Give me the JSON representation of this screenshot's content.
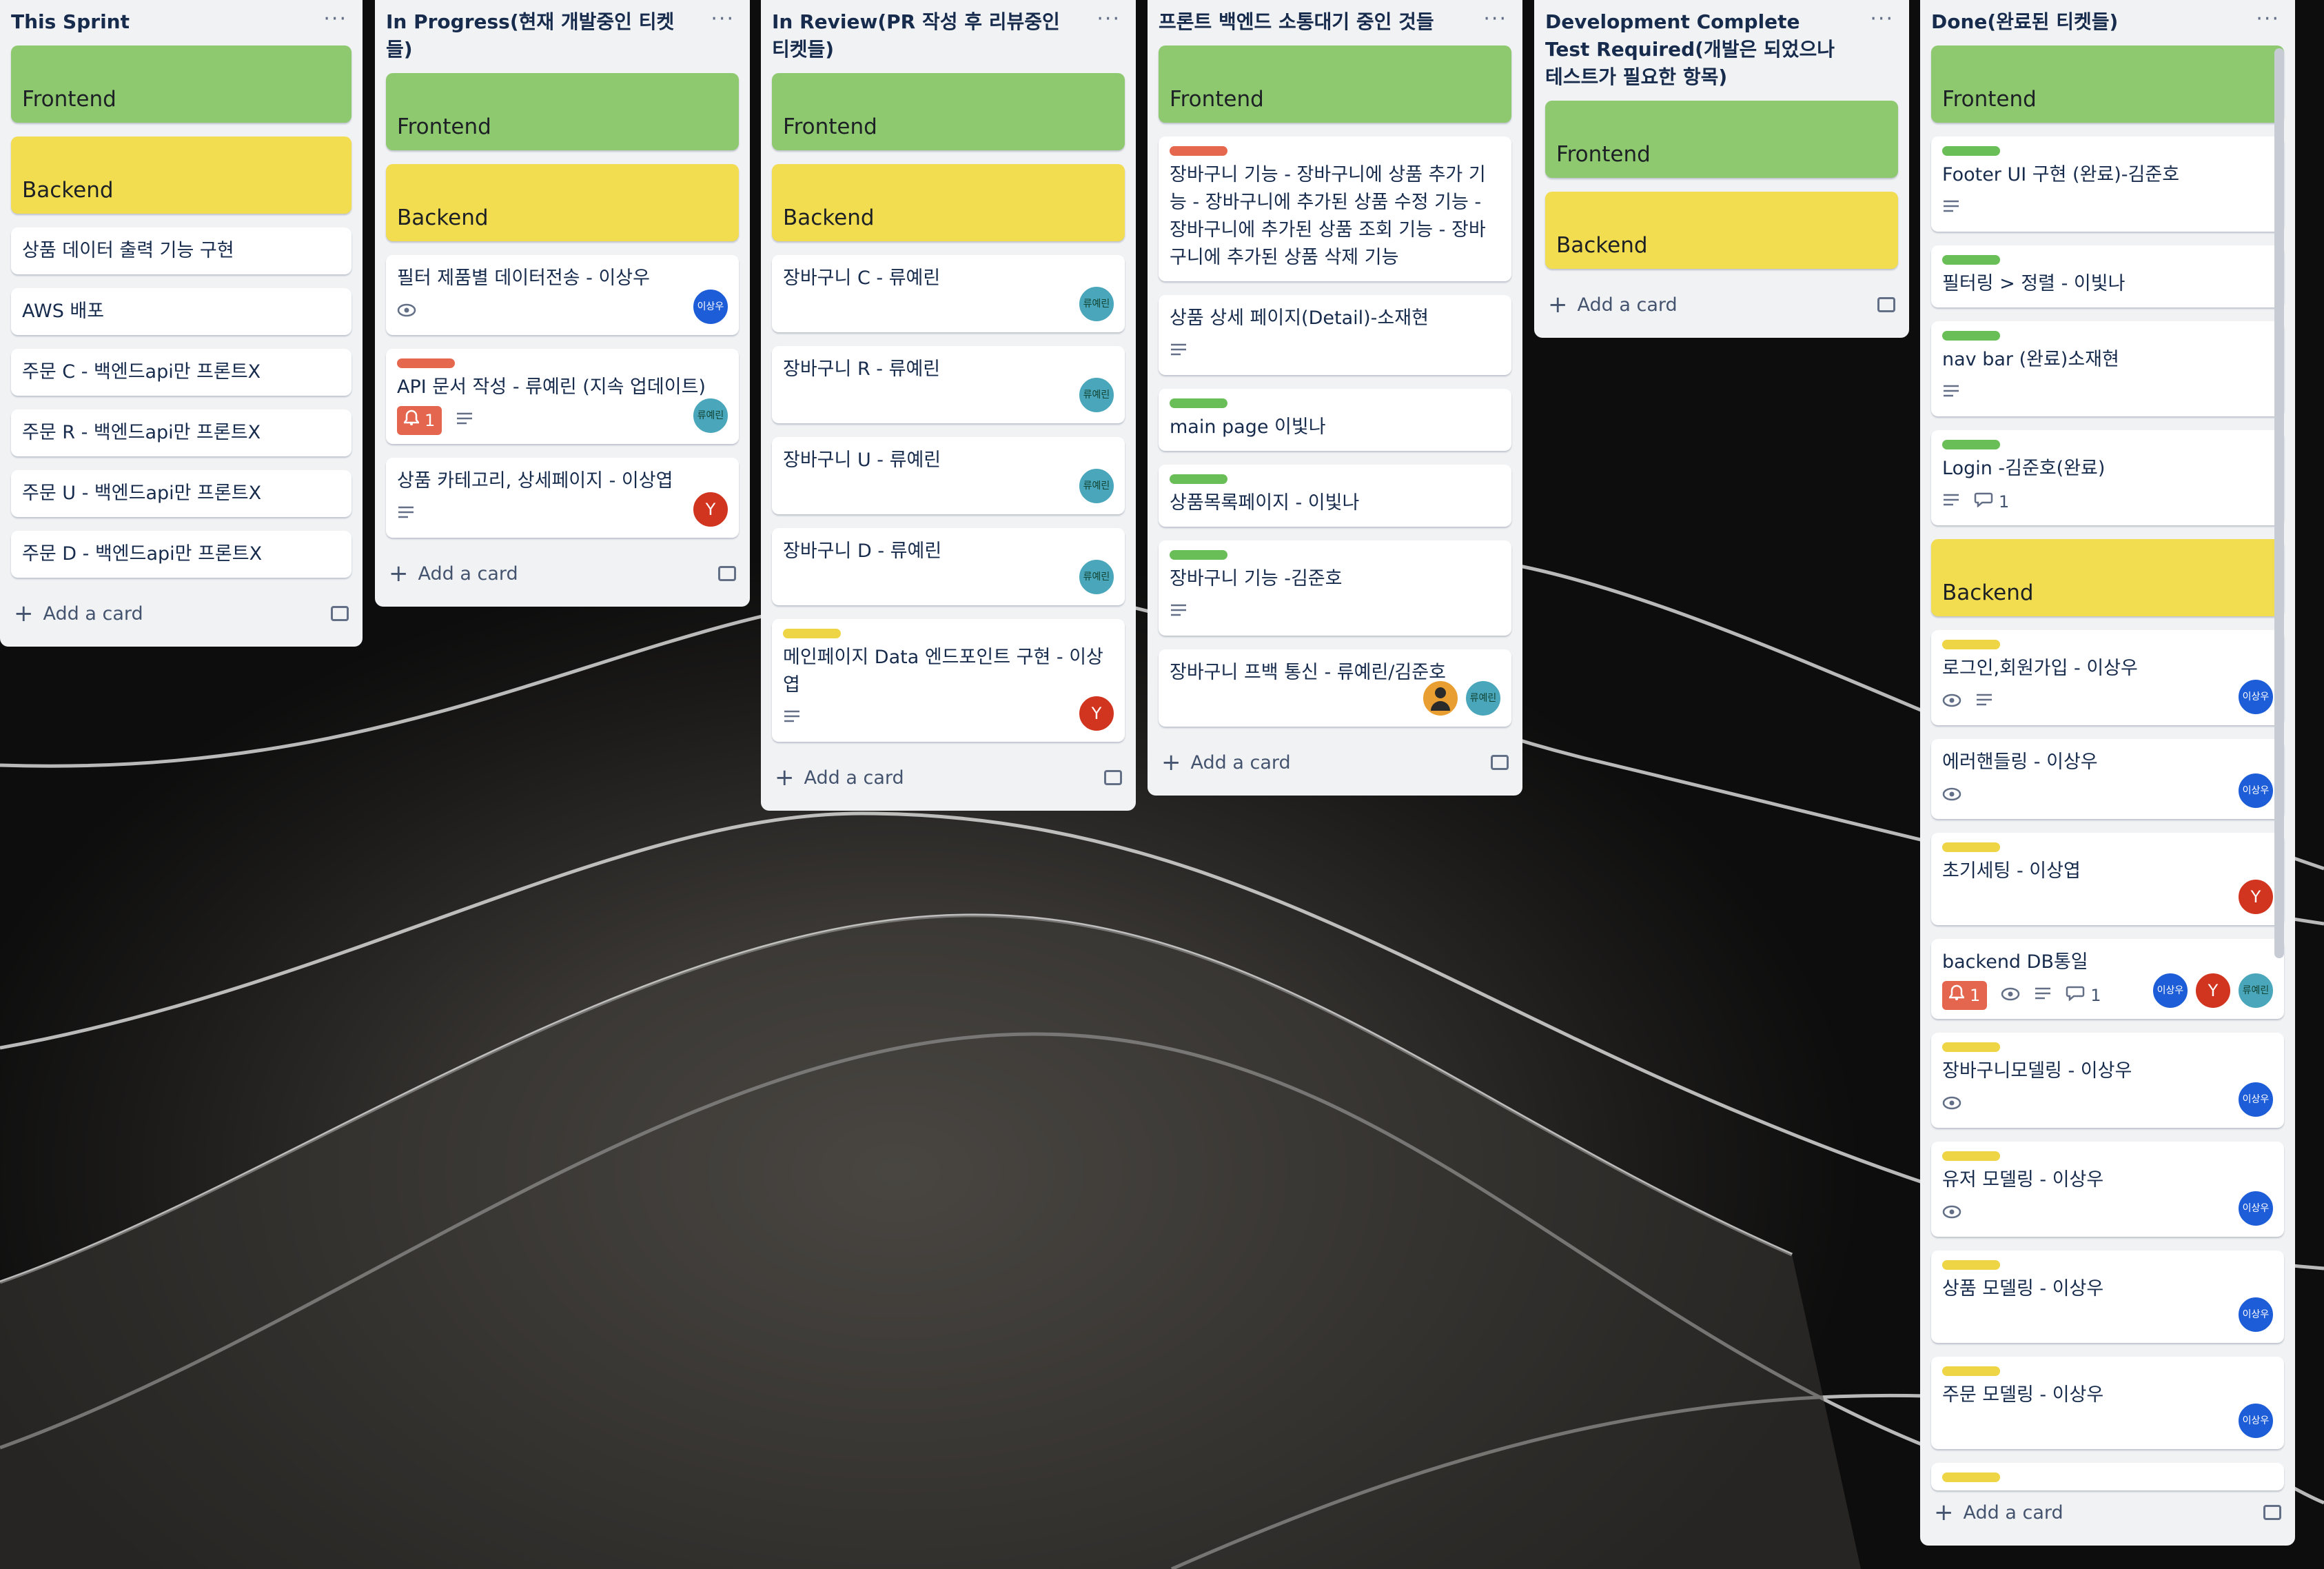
{
  "lists": [
    {
      "title": "This Sprint",
      "add_label": "Add a card",
      "cards": [
        {
          "type": "category",
          "color": "green",
          "title": "Frontend"
        },
        {
          "type": "category",
          "color": "yellow",
          "title": "Backend"
        },
        {
          "type": "card",
          "title": "상품 데이터 출력 기능 구현"
        },
        {
          "type": "card",
          "title": "AWS 배포"
        },
        {
          "type": "card",
          "title": "주문 C - 백엔드api만 프론트X"
        },
        {
          "type": "card",
          "title": "주문 R - 백엔드api만 프론트X"
        },
        {
          "type": "card",
          "title": "주문 U - 백엔드api만 프론트X"
        },
        {
          "type": "card",
          "title": "주문 D - 백엔드api만 프론트X"
        }
      ]
    },
    {
      "title": "In Progress(현재 개발중인 티켓들)",
      "add_label": "Add a card",
      "cards": [
        {
          "type": "category",
          "color": "green",
          "title": "Frontend"
        },
        {
          "type": "category",
          "color": "yellow",
          "title": "Backend"
        },
        {
          "type": "card",
          "title": "필터 제품별 데이터전송 - 이상우",
          "eye": true,
          "avatars": [
            {
              "color": "blue",
              "text": "이상우"
            }
          ]
        },
        {
          "type": "card",
          "label": "red",
          "title": "API 문서 작성 - 류예린 (지속 업데이트)",
          "alert": "1",
          "desc": true,
          "avatars": [
            {
              "color": "teal",
              "text": "류예린"
            }
          ]
        },
        {
          "type": "card",
          "title": "상품 카테고리, 상세페이지 - 이상엽",
          "desc": true,
          "avatars": [
            {
              "color": "red",
              "text": "Y"
            }
          ]
        }
      ]
    },
    {
      "title": "In Review(PR 작성 후 리뷰중인 티켓들)",
      "add_label": "Add a card",
      "cards": [
        {
          "type": "category",
          "color": "green",
          "title": "Frontend"
        },
        {
          "type": "category",
          "color": "yellow",
          "title": "Backend"
        },
        {
          "type": "card",
          "title": "장바구니 C - 류예린",
          "tall": true,
          "avatars": [
            {
              "color": "teal",
              "text": "류예린"
            }
          ]
        },
        {
          "type": "card",
          "title": "장바구니 R - 류예린",
          "tall": true,
          "avatars": [
            {
              "color": "teal",
              "text": "류예린"
            }
          ]
        },
        {
          "type": "card",
          "title": "장바구니 U - 류예린",
          "tall": true,
          "avatars": [
            {
              "color": "teal",
              "text": "류예린"
            }
          ]
        },
        {
          "type": "card",
          "title": "장바구니 D - 류예린",
          "tall": true,
          "avatars": [
            {
              "color": "teal",
              "text": "류예린"
            }
          ]
        },
        {
          "type": "card",
          "label": "yellow",
          "title": "메인페이지 Data 엔드포인트 구현 - 이상엽",
          "desc": true,
          "avatars": [
            {
              "color": "red",
              "text": "Y"
            }
          ]
        }
      ]
    },
    {
      "title": "프론트 백엔드 소통대기 중인 것들",
      "add_label": "Add a card",
      "cards": [
        {
          "type": "category",
          "color": "green",
          "title": "Frontend"
        },
        {
          "type": "card",
          "label": "red",
          "title": "장바구니 기능 - 장바구니에 상품 추가 기능 - 장바구니에 추가된 상품 수정 기능 - 장바구니에 추가된 상품 조회 기능 - 장바구니에 추가된 상품 삭제 기능"
        },
        {
          "type": "card",
          "title": "상품 상세 페이지(Detail)-소재현",
          "desc": true
        },
        {
          "type": "card",
          "label": "green",
          "title": "main page 이빛나"
        },
        {
          "type": "card",
          "label": "green",
          "title": "상품목록페이지 - 이빛나"
        },
        {
          "type": "card",
          "label": "green",
          "title": "장바구니 기능 -김준호",
          "desc": true
        },
        {
          "type": "card",
          "title": "장바구니 프백 통신 - 류예린/김준호",
          "tall": true,
          "avatars": [
            {
              "color": "orange",
              "text": "person"
            },
            {
              "color": "teal",
              "text": "류예린"
            }
          ]
        }
      ]
    },
    {
      "title": "Development Complete Test Required(개발은 되었으나 테스트가 필요한 항목)",
      "add_label": "Add a card",
      "cards": [
        {
          "type": "category",
          "color": "green",
          "title": "Frontend"
        },
        {
          "type": "category",
          "color": "yellow",
          "title": "Backend"
        }
      ]
    },
    {
      "title": "Done(완료된 티켓들)",
      "add_label": "Add a card",
      "cards": [
        {
          "type": "category",
          "color": "green",
          "title": "Frontend"
        },
        {
          "type": "card",
          "label": "green",
          "title": "Footer UI 구현 (완료)-김준호",
          "desc": true
        },
        {
          "type": "card",
          "label": "green",
          "title": "필터링 > 정렬 - 이빛나"
        },
        {
          "type": "card",
          "label": "green",
          "title": "nav bar (완료)소재현",
          "desc": true
        },
        {
          "type": "card",
          "label": "green",
          "title": "Login -김준호(완료)",
          "desc": true,
          "comments": "1"
        },
        {
          "type": "category",
          "color": "yellow",
          "title": "Backend"
        },
        {
          "type": "card",
          "label": "yellow",
          "title": "로그인,회원가입 - 이상우",
          "eye": true,
          "desc": true,
          "avatars": [
            {
              "color": "blue",
              "text": "이상우"
            }
          ]
        },
        {
          "type": "card",
          "title": "에러핸들링 - 이상우",
          "eye": true,
          "avatars": [
            {
              "color": "blue",
              "text": "이상우"
            }
          ]
        },
        {
          "type": "card",
          "label": "yellow",
          "title": "초기세팅 - 이상엽",
          "tall": true,
          "avatars": [
            {
              "color": "red",
              "text": "Y"
            }
          ]
        },
        {
          "type": "card",
          "title": "backend DB통일",
          "alert": "1",
          "eye": true,
          "desc": true,
          "comments": "1",
          "avatars": [
            {
              "color": "blue",
              "text": "이상우"
            },
            {
              "color": "red",
              "text": "Y"
            },
            {
              "color": "teal",
              "text": "류예린"
            }
          ]
        },
        {
          "type": "card",
          "label": "yellow",
          "title": "장바구니모델링 - 이상우",
          "eye": true,
          "avatars": [
            {
              "color": "blue",
              "text": "이상우"
            }
          ]
        },
        {
          "type": "card",
          "label": "yellow",
          "title": "유저 모델링 - 이상우",
          "eye": true,
          "avatars": [
            {
              "color": "blue",
              "text": "이상우"
            }
          ]
        },
        {
          "type": "card",
          "label": "yellow",
          "title": "상품 모델링 - 이상우",
          "tall": true,
          "avatars": [
            {
              "color": "blue",
              "text": "이상우"
            }
          ]
        },
        {
          "type": "card",
          "label": "yellow",
          "title": "주문 모델링 - 이상우",
          "tall": true,
          "avatars": [
            {
              "color": "blue",
              "text": "이상우"
            }
          ]
        },
        {
          "type": "card",
          "label": "yellow",
          "title": ""
        }
      ]
    }
  ]
}
